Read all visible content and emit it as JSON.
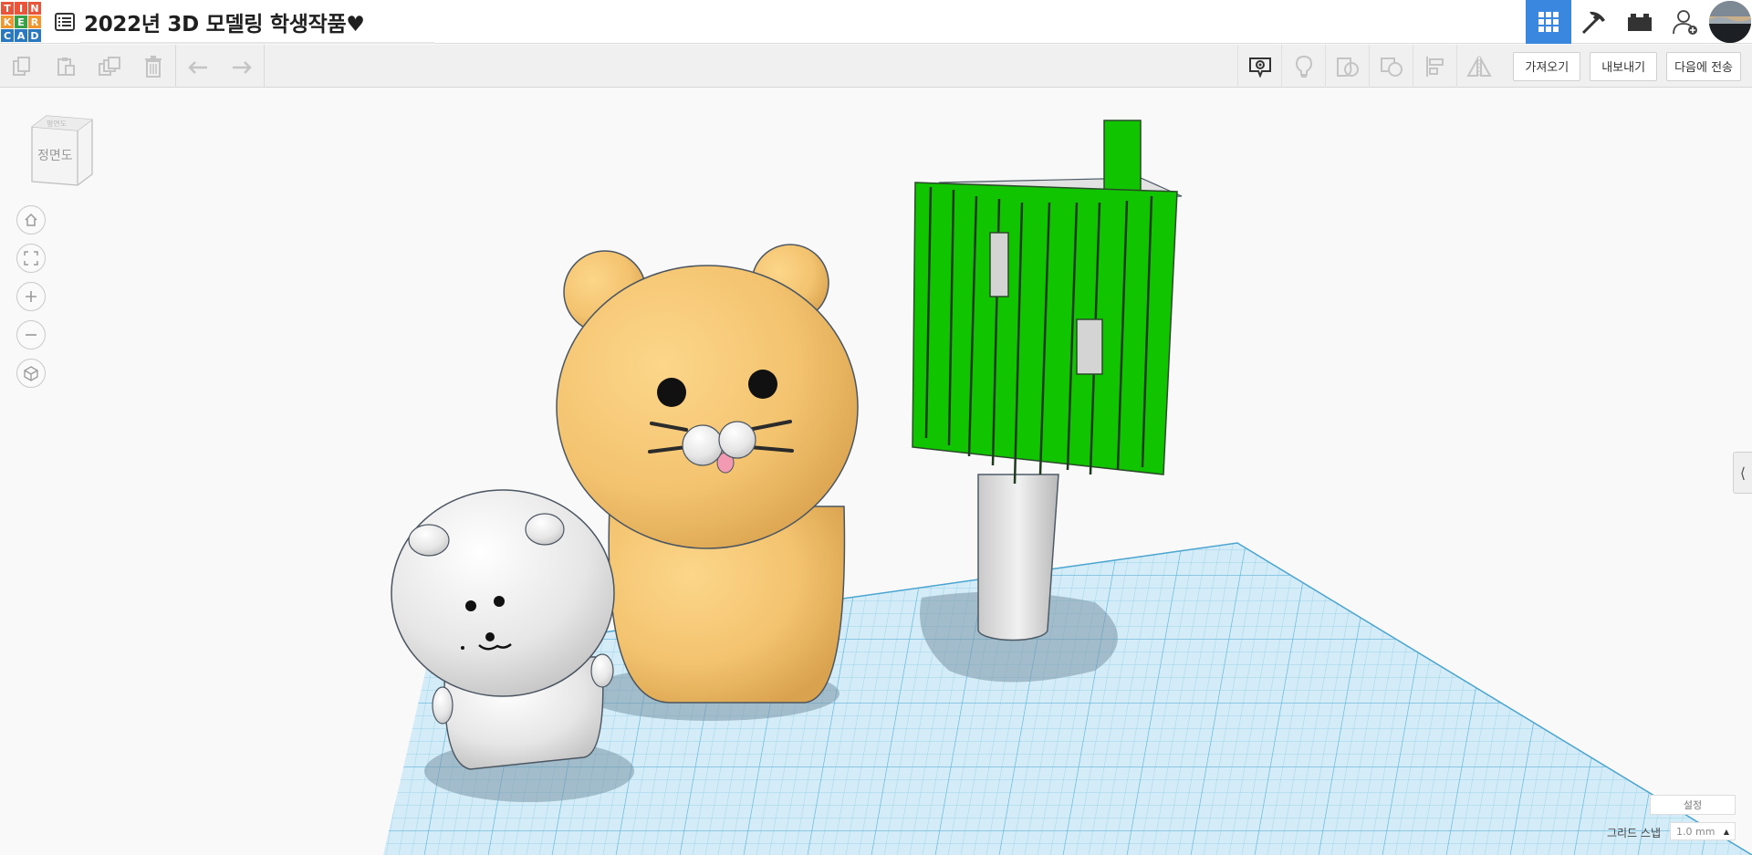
{
  "logo": {
    "letters": [
      "T",
      "I",
      "N",
      "K",
      "E",
      "R",
      "C",
      "A",
      "D"
    ],
    "colors": [
      "#e8553b",
      "#e8553b",
      "#e8553b",
      "#f1952c",
      "#39a04a",
      "#f1952c",
      "#2a79c0",
      "#2a79c0",
      "#2a79c0"
    ]
  },
  "header": {
    "title": "2022년 3D 모델링 학생작품♥",
    "list_icon": "list-icon",
    "right_buttons": [
      "grid-view-icon",
      "pickaxe-icon",
      "brick-icon",
      "add-user-icon"
    ],
    "accent": "#3a87e0"
  },
  "toolbar": {
    "left_icons": [
      "copy-icon",
      "paste-icon",
      "duplicate-icon",
      "delete-icon",
      "undo-icon",
      "redo-icon"
    ],
    "right_icons": [
      "note-icon",
      "light-icon",
      "shape-group-icon",
      "ungroup-icon",
      "align-icon",
      "mirror-icon"
    ],
    "import_label": "가져오기",
    "export_label": "내보내기",
    "send_label": "다음에 전송"
  },
  "view": {
    "cube_label": "정면도",
    "cube_top_label": "평면도",
    "controls": [
      "home-icon",
      "fit-icon",
      "zoom-in-icon",
      "zoom-out-icon",
      "perspective-icon"
    ]
  },
  "bottom": {
    "settings_label": "설정",
    "snap_label": "그리드 스냅",
    "snap_value": "1.0 mm"
  },
  "colors": {
    "workplane": "#d3ecf7",
    "grid": "#8ccbe6",
    "bear_body": "#f3c36f",
    "bear_white": "#e8e8e8",
    "tree_green": "#11c400"
  }
}
